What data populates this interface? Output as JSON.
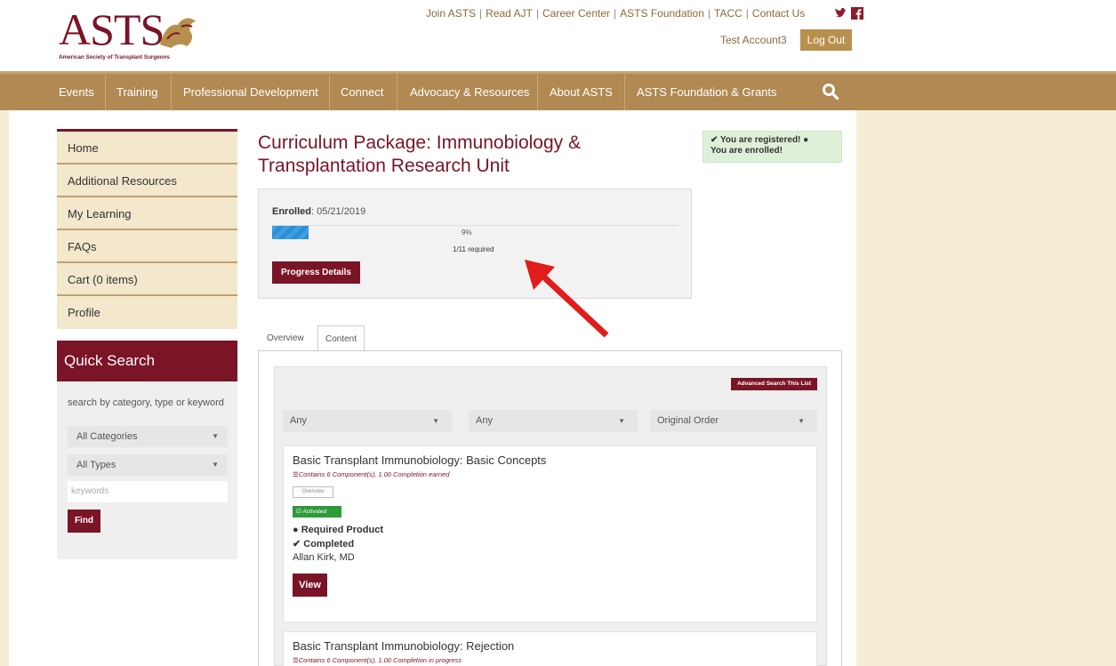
{
  "header": {
    "logo_text": "ASTS",
    "logo_tagline": "American Society of Transplant Surgeons",
    "top_links": [
      "Join ASTS",
      "Read AJT",
      "Career Center",
      "ASTS Foundation",
      "TACC",
      "Contact Us"
    ],
    "account_name": "Test Account3",
    "logout_label": "Log Out"
  },
  "nav": {
    "items": [
      "Events",
      "Training",
      "Professional Development",
      "Connect",
      "Advocacy & Resources",
      "About ASTS",
      "ASTS Foundation & Grants"
    ]
  },
  "sidebar": {
    "items": [
      "Home",
      "Additional Resources",
      "My Learning",
      "FAQs",
      "Cart (0 items)",
      "Profile"
    ]
  },
  "quick_search": {
    "title": "Quick Search",
    "label": "search by category, type or keyword",
    "category_value": "All Categories",
    "type_value": "All Types",
    "keywords_placeholder": "keywords",
    "find_label": "Find"
  },
  "main": {
    "title": "Curriculum Package: Immunobiology & Transplantation Research Unit",
    "status_registered": "✔ You are registered! ●",
    "status_enrolled": "You are enrolled!",
    "enrolled_label": "Enrolled",
    "enrolled_date": ": 05/21/2019",
    "progress_percent_value": 9,
    "progress_percent": "9%",
    "progress_required": "1/11 required",
    "progress_details_label": "Progress Details",
    "tabs": [
      "Overview",
      "Content"
    ],
    "advanced_search_label": "Advanced Search This List",
    "filters": [
      "Any",
      "Any",
      "Original Order"
    ]
  },
  "cards": [
    {
      "title": "Basic Transplant Immunobiology: Basic Concepts",
      "components": "Contains 6 Component(s), 1.00 Completion earned",
      "overview_label": "Overview",
      "activated_label": "Activated",
      "required_label": "● Required Product",
      "completed_label": "✔ Completed",
      "author": "Allan Kirk, MD",
      "view_label": "View"
    },
    {
      "title": "Basic Transplant Immunobiology: Rejection",
      "components": "Contains 6 Component(s), 1.00 Completion in progress"
    }
  ],
  "colors": {
    "brand": "#7a1426",
    "nav": "#b08a52",
    "sidebar_bg": "#f3e7cc",
    "page_bg": "#f7ecd6",
    "progress": "#2a8fd4",
    "annotation_arrow": "#e21b1b"
  }
}
